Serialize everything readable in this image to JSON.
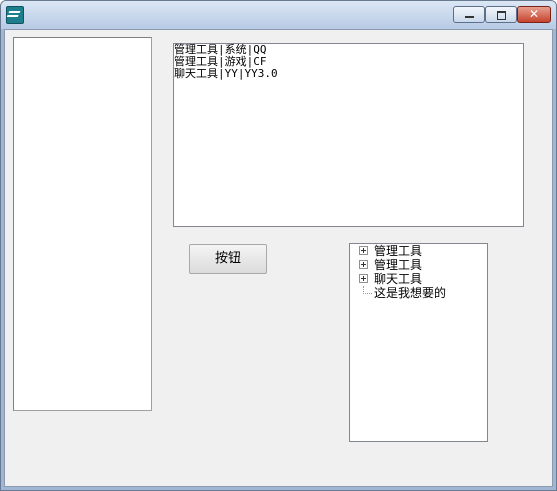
{
  "window": {
    "title": "",
    "icons": {
      "app": "app-icon",
      "minimize": "minimize-icon",
      "maximize": "maximize-icon",
      "close": "close-icon"
    },
    "close_glyph": "✕"
  },
  "left_list": {
    "items": []
  },
  "text_area": {
    "lines": [
      "管理工具|系统|QQ",
      "管理工具|游戏|CF",
      "聊天工具|YY|YY3.0"
    ]
  },
  "button": {
    "label": "按钮"
  },
  "tree": {
    "items": [
      {
        "label": "管理工具",
        "expandable": true
      },
      {
        "label": "管理工具",
        "expandable": true
      },
      {
        "label": "聊天工具",
        "expandable": true
      },
      {
        "label": "这是我想要的",
        "expandable": false
      }
    ]
  }
}
